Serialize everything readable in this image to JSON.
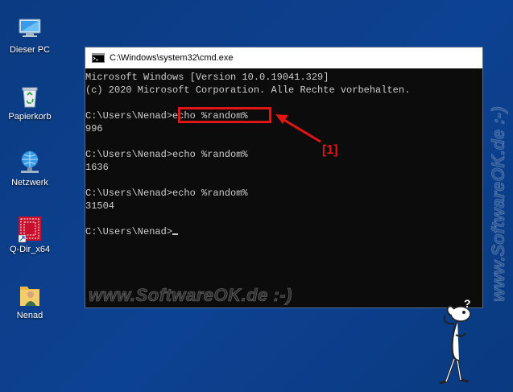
{
  "desktop": {
    "icons": [
      {
        "label": "Dieser PC",
        "icon": "computer-icon"
      },
      {
        "label": "Papierkorb",
        "icon": "recycle-bin-icon"
      },
      {
        "label": "Netzwerk",
        "icon": "network-icon"
      },
      {
        "label": "Q-Dir_x64",
        "icon": "qdir-app-icon"
      },
      {
        "label": "Nenad",
        "icon": "user-folder-icon"
      }
    ]
  },
  "window": {
    "title": "C:\\Windows\\system32\\cmd.exe",
    "icon": "cmd-icon"
  },
  "console": {
    "lines": [
      "Microsoft Windows [Version 10.0.19041.329]",
      "(c) 2020 Microsoft Corporation. Alle Rechte vorbehalten.",
      "",
      "C:\\Users\\Nenad>echo %random%",
      "996",
      "",
      "C:\\Users\\Nenad>echo %random%",
      "1636",
      "",
      "C:\\Users\\Nenad>echo %random%",
      "31504",
      "",
      "C:\\Users\\Nenad>"
    ]
  },
  "annotation": {
    "callout_label": "[1]",
    "color": "#e01515"
  },
  "watermark": {
    "bottom": "www.SoftwareOK.de :-)",
    "side": "www.SoftwareOK.de :-)"
  },
  "colors": {
    "desktop": "#0c4292",
    "console_bg": "#0c0c0c",
    "console_text": "#cccccc"
  }
}
